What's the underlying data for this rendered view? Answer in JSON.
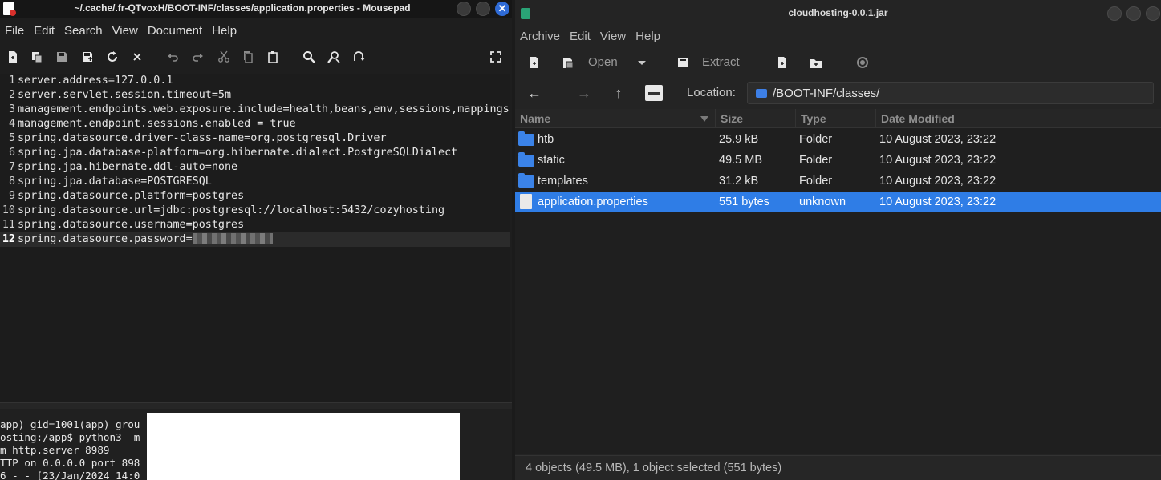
{
  "mousepad": {
    "title": "~/.cache/.fr-QTvoxH/BOOT-INF/classes/application.properties - Mousepad",
    "menu": [
      "File",
      "Edit",
      "Search",
      "View",
      "Document",
      "Help"
    ],
    "toolbar_icons": [
      "new-document-icon",
      "new-window-icon",
      "save-icon",
      "save-as-icon",
      "reload-icon",
      "close-tab-icon",
      "undo-icon",
      "redo-icon",
      "cut-icon",
      "copy-icon",
      "paste-icon",
      "find-icon",
      "find-replace-icon",
      "goto-icon",
      "fullscreen-icon"
    ],
    "lines": [
      {
        "num": "1",
        "text": "server.address=127.0.0.1"
      },
      {
        "num": "2",
        "text": "server.servlet.session.timeout=5m"
      },
      {
        "num": "3",
        "text": "management.endpoints.web.exposure.include=health,beans,env,sessions,mappings"
      },
      {
        "num": "4",
        "text": "management.endpoint.sessions.enabled = true"
      },
      {
        "num": "5",
        "text": "spring.datasource.driver-class-name=org.postgresql.Driver"
      },
      {
        "num": "6",
        "text": "spring.jpa.database-platform=org.hibernate.dialect.PostgreSQLDialect"
      },
      {
        "num": "7",
        "text": "spring.jpa.hibernate.ddl-auto=none"
      },
      {
        "num": "8",
        "text": "spring.jpa.database=POSTGRESQL"
      },
      {
        "num": "9",
        "text": "spring.datasource.platform=postgres"
      },
      {
        "num": "10",
        "text": "spring.datasource.url=jdbc:postgresql://localhost:5432/cozyhosting"
      },
      {
        "num": "11",
        "text": "spring.datasource.username=postgres"
      },
      {
        "num": "12",
        "text": "spring.datasource.password="
      }
    ],
    "current_line": 12
  },
  "terminal": {
    "lines": [
      "app) gid=1001(app) grou",
      "osting:/app$ python3 -m",
      "m http.server 8989",
      "TTP on 0.0.0.0 port 898",
      "6 - - [23/Jan/2024 14:0"
    ]
  },
  "archive": {
    "title": "cloudhosting-0.0.1.jar",
    "menu": [
      "Archive",
      "Edit",
      "View",
      "Help"
    ],
    "toolbar": {
      "open": "Open",
      "extract": "Extract"
    },
    "location_label": "Location:",
    "location_value": "/BOOT-INF/classes/",
    "columns": {
      "name": "Name",
      "size": "Size",
      "type": "Type",
      "date": "Date Modified"
    },
    "rows": [
      {
        "name": "htb",
        "size": "25.9 kB",
        "type": "Folder",
        "date": "10 August 2023, 23:22",
        "kind": "folder",
        "selected": false
      },
      {
        "name": "static",
        "size": "49.5 MB",
        "type": "Folder",
        "date": "10 August 2023, 23:22",
        "kind": "folder",
        "selected": false
      },
      {
        "name": "templates",
        "size": "31.2 kB",
        "type": "Folder",
        "date": "10 August 2023, 23:22",
        "kind": "folder",
        "selected": false
      },
      {
        "name": "application.properties",
        "size": "551 bytes",
        "type": "unknown",
        "date": "10 August 2023, 23:22",
        "kind": "file",
        "selected": true
      }
    ],
    "status": "4 objects (49.5 MB), 1 object selected (551 bytes)",
    "colors": {
      "selection": "#2f7de6",
      "folder": "#3b83e8"
    }
  }
}
